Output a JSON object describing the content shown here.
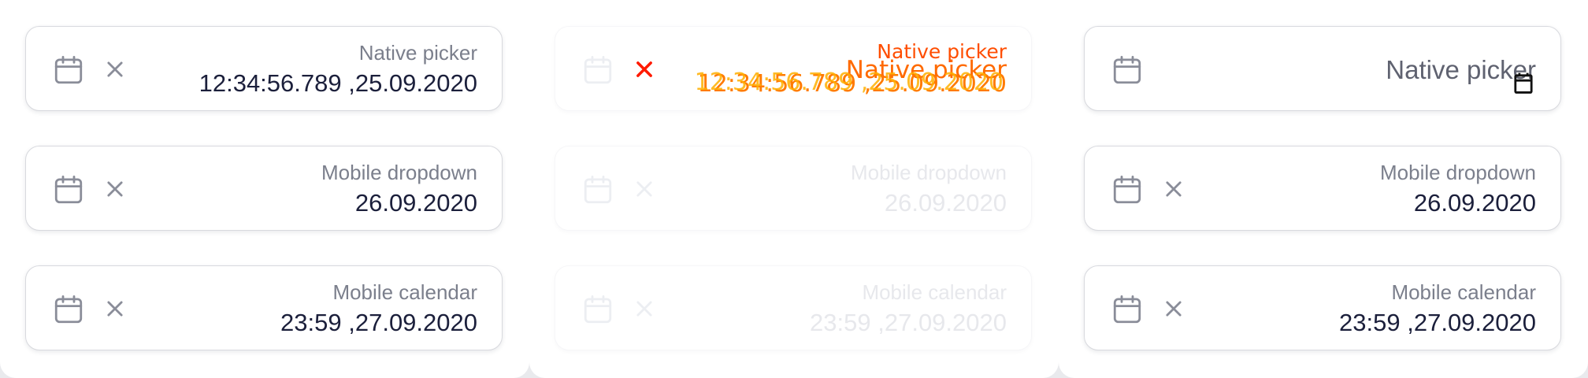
{
  "colors": {
    "icon_gray": "#8a8d99",
    "disabled_gray": "#eceef2",
    "clear_red": "#ff1a00",
    "text_dark": "#1b1f3b",
    "label_gray": "#7b7f8c"
  },
  "columns": [
    {
      "state": "default",
      "fields": [
        {
          "label": "Native picker",
          "value": "12:34:56.789 ,25.09.2020",
          "icon": "calendar-icon",
          "clear_icon": "close-icon"
        },
        {
          "label": "Mobile dropdown",
          "value": "26.09.2020",
          "icon": "calendar-icon",
          "clear_icon": "close-icon"
        },
        {
          "label": "Mobile calendar",
          "value": "23:59 ,27.09.2020",
          "icon": "calendar-icon",
          "clear_icon": "close-icon"
        }
      ]
    },
    {
      "state": "disabled",
      "fields": [
        {
          "label": "Native picker",
          "value": "12:34:56.789 ,25.09.2020",
          "icon": "calendar-icon",
          "clear_icon": "close-icon"
        },
        {
          "label": "Mobile dropdown",
          "value": "26.09.2020",
          "icon": "calendar-icon",
          "clear_icon": "close-icon"
        },
        {
          "label": "Mobile calendar",
          "value": "23:59 ,27.09.2020",
          "icon": "calendar-icon",
          "clear_icon": "close-icon"
        }
      ]
    },
    {
      "state": "native-empty",
      "fields": [
        {
          "label": "Native picker",
          "value": "",
          "icon": "calendar-icon",
          "native_icon": "native-calendar-icon"
        },
        {
          "label": "Mobile dropdown",
          "value": "26.09.2020",
          "icon": "calendar-icon",
          "clear_icon": "close-icon"
        },
        {
          "label": "Mobile calendar",
          "value": "23:59 ,27.09.2020",
          "icon": "calendar-icon",
          "clear_icon": "close-icon"
        }
      ]
    }
  ]
}
